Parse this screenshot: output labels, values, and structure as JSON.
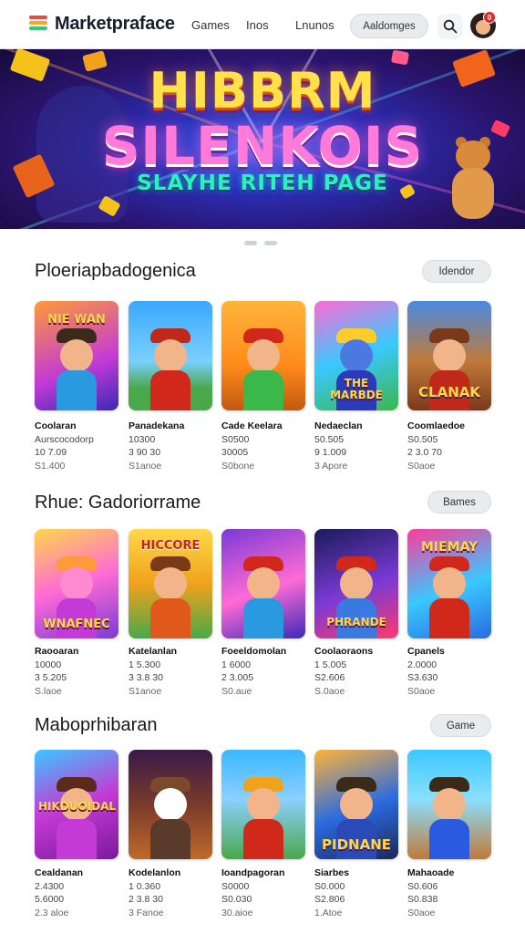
{
  "header": {
    "brand": "Marketpraface",
    "nav": [
      "Games",
      "Inos",
      "Lnunos"
    ],
    "search_label": "Aaldomges",
    "notification_count": "0"
  },
  "hero": {
    "title_line1": "HIBBRM",
    "title_line2": "SILENKOIS",
    "subtitle": "SLAYHE RITEH PAGE"
  },
  "sections": [
    {
      "title": "Ploeriapbadogenica",
      "button": "Idendor",
      "cards": [
        {
          "caption": "NIE WAN",
          "name": "Coolaran",
          "line2": "Aurscocodorp",
          "line3": "10 7.09",
          "line4": "S1.400"
        },
        {
          "caption": "",
          "name": "Panadekana",
          "line2": "10300",
          "line3": "3 90 30",
          "line4": "S1anoe"
        },
        {
          "caption": "",
          "name": "Cade Keelara",
          "line2": "S0500",
          "line3": "30005",
          "line4": "S0bone"
        },
        {
          "caption": "THE MARBDE",
          "name": "Nedaeclan",
          "line2": "50.505",
          "line3": "9 1.009",
          "line4": "3 Apore"
        },
        {
          "caption": "CLANAK",
          "name": "Coomlaedoe",
          "line2": "S0.505",
          "line3": "2 3.0 70",
          "line4": "S0aoe"
        }
      ]
    },
    {
      "title": "Rhue: Gadoriorrame",
      "button": "Bames",
      "cards": [
        {
          "caption": "WNAFNEC",
          "name": "Raooaran",
          "line2": "10000",
          "line3": "3 5.205",
          "line4": "S.laoe"
        },
        {
          "caption": "HICCORE",
          "name": "Katelanlan",
          "line2": "1 5.300",
          "line3": "3 3.8 30",
          "line4": "S1anoe"
        },
        {
          "caption": "",
          "name": "Foeeldomolan",
          "line2": "1 6000",
          "line3": "2 3.005",
          "line4": "S0.aue"
        },
        {
          "caption": "PHRANDE",
          "name": "Coolaoraons",
          "line2": "1 5.005",
          "line3": "S2.606",
          "line4": "S.0aoe"
        },
        {
          "caption": "MIEMAY",
          "name": "Cpanels",
          "line2": "2.0000",
          "line3": "S3.630",
          "line4": "S0aoe"
        }
      ]
    },
    {
      "title": "Maboprhibaran",
      "button": "Game",
      "cards": [
        {
          "caption": "HIKDUOIDAL",
          "name": "Cealdanan",
          "line2": "2.4300",
          "line3": "5.6000",
          "line4": "2.3 aloe"
        },
        {
          "caption": "",
          "name": "Kodelanlon",
          "line2": "1 0.360",
          "line3": "2 3.8 30",
          "line4": "3 Fanoe"
        },
        {
          "caption": "",
          "name": "Ioandpagoran",
          "line2": "S0000",
          "line3": "S0.030",
          "line4": "30.aioe"
        },
        {
          "caption": "PIDNANE",
          "name": "Siarbes",
          "line2": "S0.000",
          "line3": "S2.806",
          "line4": "1.Atoe"
        },
        {
          "caption": "",
          "name": "Mahaoade",
          "line2": "S0.606",
          "line3": "S0.838",
          "line4": "S0aoe"
        }
      ]
    }
  ],
  "colors": {
    "accent": "#e3262b",
    "pill_bg": "#e9ecef"
  }
}
